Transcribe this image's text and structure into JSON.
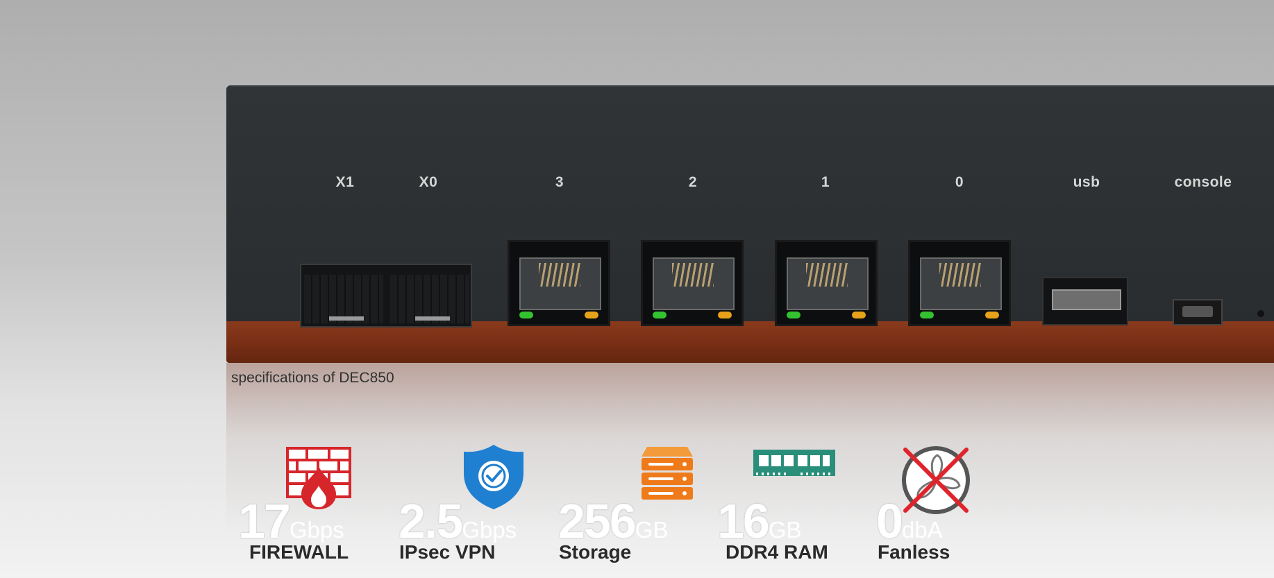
{
  "device": {
    "port_labels": [
      "X1",
      "X0",
      "3",
      "2",
      "1",
      "0",
      "usb",
      "console"
    ]
  },
  "caption": "specifications of DEC850",
  "specs": [
    {
      "value": "17",
      "unit": "Gbps",
      "label": "FIREWALL",
      "icon": "firewall-icon",
      "color": "#d6262b"
    },
    {
      "value": "2.5",
      "unit": "Gbps",
      "label": "IPsec VPN",
      "icon": "shield-check-icon",
      "color": "#1f7fd0"
    },
    {
      "value": "256",
      "unit": "GB",
      "label": "Storage",
      "icon": "server-storage-icon",
      "color": "#ef7a1a"
    },
    {
      "value": "16",
      "unit": "GB",
      "label": "DDR4 RAM",
      "icon": "memory-module-icon",
      "color": "#2a8f7a"
    },
    {
      "value": "0",
      "unit": "dbA",
      "label": "Fanless",
      "icon": "no-fan-icon",
      "color": "#e0242b"
    }
  ]
}
